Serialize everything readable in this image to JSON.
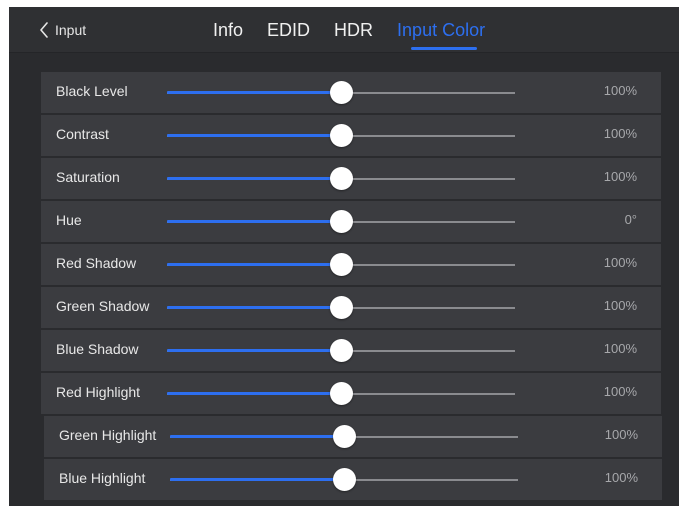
{
  "header": {
    "back_label": "Input",
    "tabs": [
      {
        "label": "Info",
        "active": false
      },
      {
        "label": "EDID",
        "active": false
      },
      {
        "label": "HDR",
        "active": false
      },
      {
        "label": "Input Color",
        "active": true
      }
    ]
  },
  "colors": {
    "accent": "#2d6ff0",
    "background": "#2a2b2e",
    "row_background": "#3b3c40"
  },
  "rows": [
    {
      "label": "Black Level",
      "value": "100%",
      "slider_fraction": 0.5
    },
    {
      "label": "Contrast",
      "value": "100%",
      "slider_fraction": 0.5
    },
    {
      "label": "Saturation",
      "value": "100%",
      "slider_fraction": 0.5
    },
    {
      "label": "Hue",
      "value": "0°",
      "slider_fraction": 0.5
    },
    {
      "label": "Red Shadow",
      "value": "100%",
      "slider_fraction": 0.5
    },
    {
      "label": "Green Shadow",
      "value": "100%",
      "slider_fraction": 0.5
    },
    {
      "label": "Blue Shadow",
      "value": "100%",
      "slider_fraction": 0.5
    },
    {
      "label": "Red Highlight",
      "value": "100%",
      "slider_fraction": 0.5
    },
    {
      "label": "Green Highlight",
      "value": "100%",
      "slider_fraction": 0.5
    },
    {
      "label": "Blue Highlight",
      "value": "100%",
      "slider_fraction": 0.5
    }
  ]
}
